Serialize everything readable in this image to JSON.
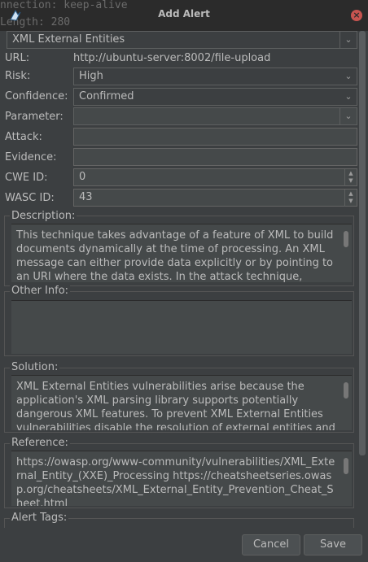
{
  "window": {
    "title": "Add Alert",
    "background_lines": [
      "nnection: keep-alive",
      "Length: 280"
    ]
  },
  "alert": {
    "name": "XML External Entities",
    "url_label": "URL:",
    "url_value": "http://ubuntu-server:8002/file-upload",
    "risk_label": "Risk:",
    "risk_value": "High",
    "confidence_label": "Confidence:",
    "confidence_value": "Confirmed",
    "parameter_label": "Parameter:",
    "parameter_value": "",
    "attack_label": "Attack:",
    "attack_value": "",
    "evidence_label": "Evidence:",
    "evidence_value": "",
    "cwe_label": "CWE ID:",
    "cwe_value": "0",
    "wasc_label": "WASC ID:",
    "wasc_value": "43"
  },
  "sections": {
    "description_title": "Description:",
    "description_text": "This technique takes advantage of a feature of XML to build documents dynamically at the time of processing. An XML message can either provide data explicitly or by pointing to an URI where the data exists. In the attack technique, external",
    "other_info_title": "Other Info:",
    "other_info_text": "",
    "solution_title": "Solution:",
    "solution_text": "XML External Entities vulnerabilities arise because the application's XML parsing library supports potentially dangerous XML features. To prevent XML External Entities vulnerabilities disable the resolution of external entities and",
    "reference_title": "Reference:",
    "reference_text": "https://owasp.org/www-community/vulnerabilities/XML_External_Entity_(XXE)_Processing https://cheatsheetseries.owasp.org/cheatsheets/XML_External_Entity_Prevention_Cheat_Sheet.html",
    "tags_title": "Alert Tags:"
  },
  "buttons": {
    "cancel": "Cancel",
    "save": "Save"
  },
  "colors": {
    "background": "#3c3f41",
    "titlebar": "#2b2b2b",
    "close": "#c75450",
    "text": "#bbbbbb"
  }
}
